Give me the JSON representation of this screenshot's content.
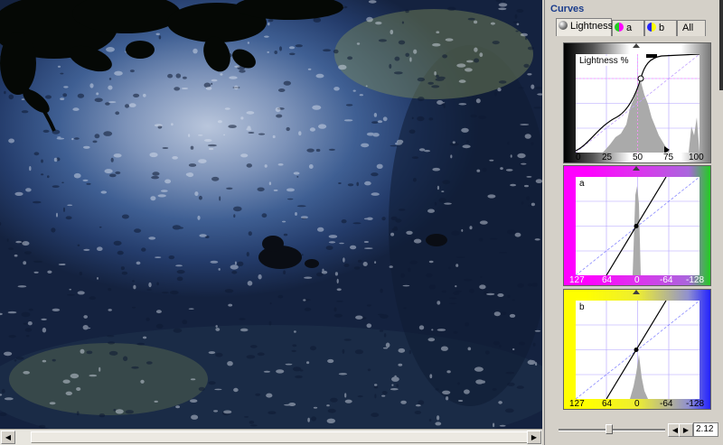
{
  "panel": {
    "title": "Curves",
    "tabs": [
      {
        "label": "Lightness",
        "icon": "lightness-channel-icon"
      },
      {
        "label": "a",
        "icon": "a-channel-icon"
      },
      {
        "label": "b",
        "icon": "b-channel-icon"
      },
      {
        "label": "All",
        "icon": ""
      }
    ],
    "lightness": {
      "label": "Lightness %",
      "ticks": [
        "0",
        "25",
        "50",
        "75",
        "100"
      ]
    },
    "a_channel": {
      "label": "a",
      "ticks": [
        "127",
        "64",
        "0",
        "-64",
        "-128"
      ]
    },
    "b_channel": {
      "label": "b",
      "ticks": [
        "127",
        "64",
        "0",
        "-64",
        "-128"
      ]
    },
    "zoom_value": "2.12"
  },
  "colors": {
    "a_left": "#ff00ff",
    "a_right": "#22cc22",
    "b_left": "#ffff00",
    "b_right": "#2222ff",
    "panel_bg": "#d4d0c8"
  }
}
